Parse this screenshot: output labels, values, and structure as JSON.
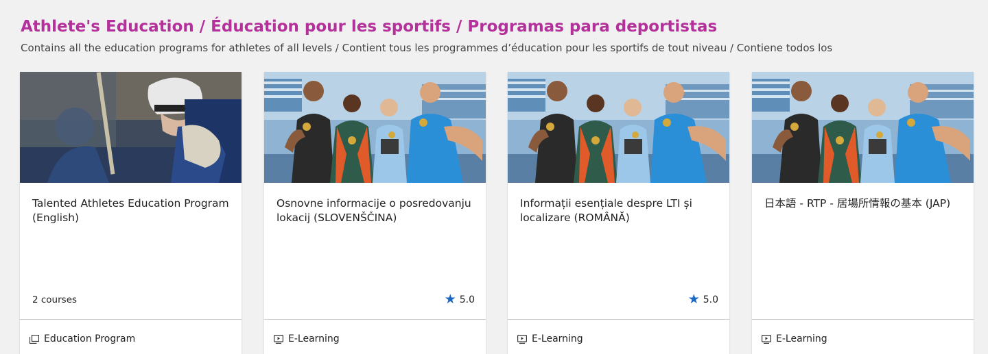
{
  "section": {
    "title": "Athlete's Education / Éducation pour les sportifs / Programas para deportistas",
    "subtitle": "Contains all the education programs for athletes of all levels / Contient tous les programmes d’éducation pour les sportifs de tout niveau / Contiene todos los"
  },
  "cards": [
    {
      "title": "Talented Athletes Education Program (English)",
      "meta": "2 courses",
      "type": "Education Program",
      "type_icon": "education-program-icon",
      "image": "hockey-player-photo"
    },
    {
      "title": "Osnovne informacije o posredovanju lokacij (SLOVENŠČINA)",
      "rating": "5.0",
      "type": "E-Learning",
      "type_icon": "e-learning-icon",
      "image": "athletes-with-medals-photo"
    },
    {
      "title": "Informații esențiale despre LTI și localizare (ROMÂNĂ)",
      "rating": "5.0",
      "type": "E-Learning",
      "type_icon": "e-learning-icon",
      "image": "athletes-with-medals-photo"
    },
    {
      "title": "日本語 - RTP - 居場所情報の基本 (JAP)",
      "type": "E-Learning",
      "type_icon": "e-learning-icon",
      "image": "athletes-with-medals-photo"
    }
  ],
  "colors": {
    "title": "#b4309a",
    "star": "#1a66c0",
    "background": "#f1f1f1"
  }
}
